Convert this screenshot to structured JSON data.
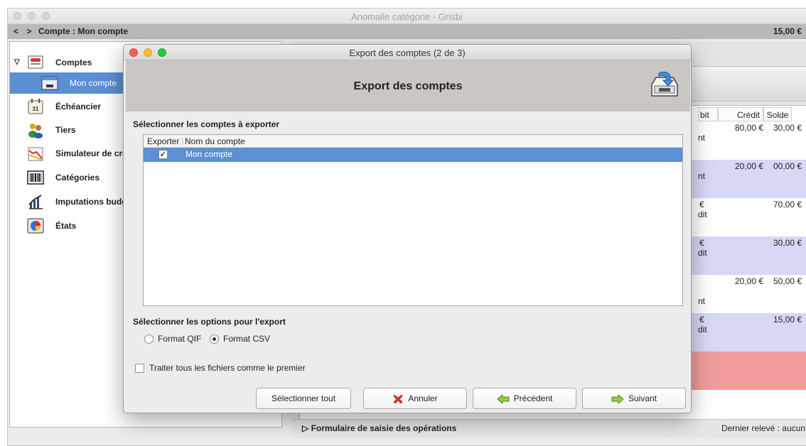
{
  "main_window": {
    "title": "Anomalie catégorie - Grisbi",
    "nav_arrows": "< >",
    "account_path": "Compte : Mon compte",
    "balance": "15,00 €"
  },
  "sidebar": {
    "items": [
      {
        "label": "Comptes",
        "icon": "accounts-icon"
      },
      {
        "label": "Mon compte",
        "icon": "account-card-icon",
        "selected": true
      },
      {
        "label": "Échéancier",
        "icon": "calendar-icon"
      },
      {
        "label": "Tiers",
        "icon": "people-icon"
      },
      {
        "label": "Simulateur de cré",
        "icon": "chart-icon"
      },
      {
        "label": "Catégories",
        "icon": "barcode-icon"
      },
      {
        "label": "Imputations budg",
        "icon": "budget-chart-icon"
      },
      {
        "label": "États",
        "icon": "pie-report-icon"
      }
    ]
  },
  "table": {
    "headers": {
      "debit": "bit",
      "credit": "Crédit",
      "solde": "Solde"
    },
    "rows": [
      {
        "col_a": "nt",
        "credit": "80,00 €",
        "solde": "30,00 €"
      },
      {
        "col_a": "nt",
        "credit": "20,00 €",
        "solde": "00,00 €"
      },
      {
        "col_a_top": "€",
        "col_a": "dit",
        "credit": "",
        "solde": "70,00 €"
      },
      {
        "col_a_top": "€",
        "col_a": "dit",
        "credit": "",
        "solde": "30,00 €"
      },
      {
        "col_a": "nt",
        "credit": "20,00 €",
        "solde": "50,00 €"
      },
      {
        "col_a_top": "€",
        "col_a": "dit",
        "credit": "",
        "solde": "15,00 €"
      }
    ]
  },
  "bottom_bar": {
    "form_toggle": "Formulaire de saisie des opérations",
    "last_statement": "Dernier relevé : aucun"
  },
  "dialog": {
    "title": "Export des comptes (2 de 3)",
    "header_title": "Export des comptes",
    "accounts_section": "Sélectionner les comptes à exporter",
    "list_headers": {
      "export": "Exporter",
      "name": "Nom du compte"
    },
    "accounts": [
      {
        "name": "Mon compte",
        "checked": true
      }
    ],
    "options_section": "Sélectionner les options pour l'export",
    "format_qif": "Format QIF",
    "format_csv": "Format CSV",
    "selected_format": "CSV",
    "treat_all_label": "Traiter tous les fichiers comme le premier",
    "buttons": {
      "select_all": "Sélectionner tout",
      "cancel": "Annuler",
      "previous": "Précédent",
      "next": "Suivant"
    }
  },
  "colors": {
    "selection": "#5b8fd3",
    "row_alt": "#d6d8f5",
    "row_error": "#f09c9c",
    "header_band": "#cac6c4"
  }
}
